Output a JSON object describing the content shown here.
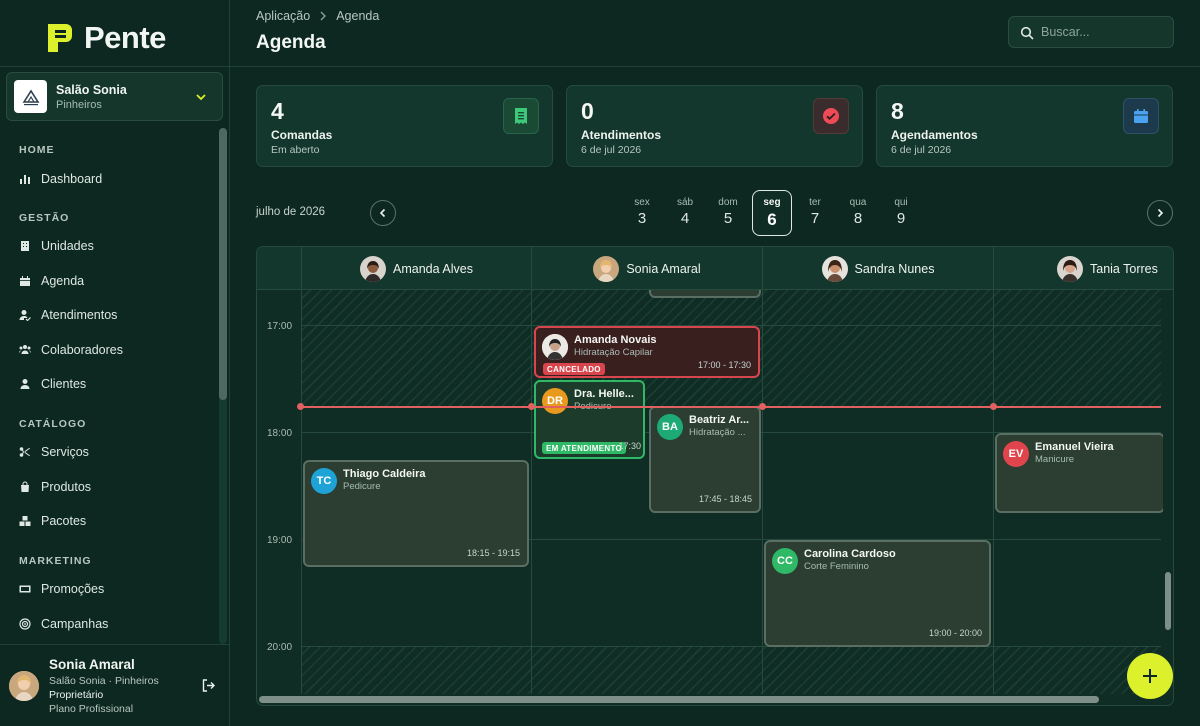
{
  "brand": {
    "name": "Pente"
  },
  "unit": {
    "name": "Salão Sonia",
    "location": "Pinheiros"
  },
  "nav": {
    "sections": [
      {
        "title": "HOME",
        "items": [
          {
            "label": "Dashboard",
            "icon": "bar-chart-icon"
          }
        ]
      },
      {
        "title": "GESTÃO",
        "items": [
          {
            "label": "Unidades",
            "icon": "building-icon"
          },
          {
            "label": "Agenda",
            "icon": "calendar-icon"
          },
          {
            "label": "Atendimentos",
            "icon": "user-check-icon"
          },
          {
            "label": "Colaboradores",
            "icon": "users-icon"
          },
          {
            "label": "Clientes",
            "icon": "user-icon"
          }
        ]
      },
      {
        "title": "CATÁLOGO",
        "items": [
          {
            "label": "Serviços",
            "icon": "scissors-icon"
          },
          {
            "label": "Produtos",
            "icon": "bag-icon"
          },
          {
            "label": "Pacotes",
            "icon": "boxes-icon"
          }
        ]
      },
      {
        "title": "MARKETING",
        "items": [
          {
            "label": "Promoções",
            "icon": "ticket-icon"
          },
          {
            "label": "Campanhas",
            "icon": "target-icon"
          }
        ]
      }
    ]
  },
  "user": {
    "name": "Sonia Amaral",
    "unit_line": "Salão Sonia · Pinheiros",
    "role": "Proprietário",
    "plan": "Plano Profissional"
  },
  "breadcrumb": {
    "root": "Aplicação",
    "current": "Agenda"
  },
  "page": {
    "title": "Agenda"
  },
  "search": {
    "placeholder": "Buscar..."
  },
  "stats": [
    {
      "value": "4",
      "label": "Comandas",
      "sub": "Em aberto",
      "icon": "receipt-icon",
      "color": "#3ec97a"
    },
    {
      "value": "0",
      "label": "Atendimentos",
      "sub": "6 de jul 2026",
      "icon": "check-circle-icon",
      "color": "#ef4b57"
    },
    {
      "value": "8",
      "label": "Agendamentos",
      "sub": "6 de jul 2026",
      "icon": "calendar-icon",
      "color": "#4aa3f0"
    }
  ],
  "calendar": {
    "month": "julho de 2026",
    "days": [
      {
        "dow": "sex",
        "num": "3"
      },
      {
        "dow": "sáb",
        "num": "4"
      },
      {
        "dow": "dom",
        "num": "5"
      },
      {
        "dow": "seg",
        "num": "6",
        "selected": true
      },
      {
        "dow": "ter",
        "num": "7"
      },
      {
        "dow": "qua",
        "num": "8"
      },
      {
        "dow": "qui",
        "num": "9"
      }
    ],
    "professionals": [
      "Amanda Alves",
      "Sonia Amaral",
      "Sandra Nunes",
      "Tania Torres"
    ],
    "times": [
      "17:00",
      "18:00",
      "19:00",
      "20:00"
    ]
  },
  "events": {
    "e1": {
      "name": "Amanda Novais",
      "service": "Hidratação Capilar",
      "time": "17:00 - 17:30",
      "status": "CANCELADO"
    },
    "e2": {
      "initials": "DR",
      "name": "Dra. Helle...",
      "service": "Pedicure",
      "time": "17:30",
      "status": "EM ATENDIMENTO"
    },
    "e3": {
      "initials": "BA",
      "name": "Beatriz Ar...",
      "service": "Hidratação ...",
      "time": "17:45 - 18:45"
    },
    "e4": {
      "initials": "TC",
      "name": "Thiago Caldeira",
      "service": "Pedicure",
      "time": "18:15 - 19:15"
    },
    "e5": {
      "initials": "EV",
      "name": "Emanuel Vieira",
      "service": "Manicure"
    },
    "e6": {
      "initials": "CC",
      "name": "Carolina Cardoso",
      "service": "Corte Feminino",
      "time": "19:00 - 20:00"
    }
  }
}
